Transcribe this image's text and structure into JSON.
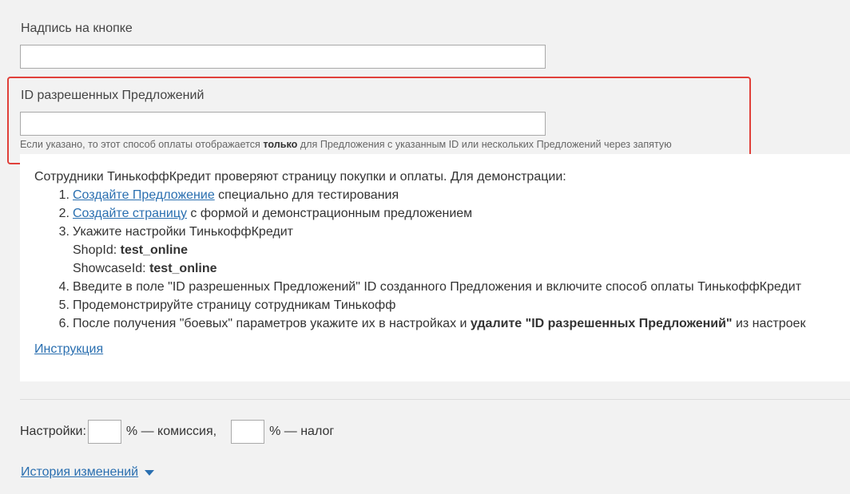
{
  "button_caption": {
    "label": "Надпись на кнопке",
    "value": ""
  },
  "allowed_offers": {
    "label": "ID разрешенных Предложений",
    "value": "",
    "hint_before": "Если указано, то этот способ оплаты отображается ",
    "hint_bold": "только",
    "hint_after": " для Предложения с указанным ID или нескольких Предложений через запятую"
  },
  "info": {
    "intro": "Сотрудники ТинькоффКредит проверяют страницу покупки и оплаты. Для демонстрации:",
    "steps": [
      {
        "num": "1.",
        "link": "Создайте Предложение",
        "text": " специально для тестирования"
      },
      {
        "num": "2.",
        "link": "Создайте страницу",
        "text": " с формой и демонстрационным предложением"
      },
      {
        "num": "3.",
        "text": "Укажите настройки ТинькоффКредит"
      },
      {
        "num": "4.",
        "text": "Введите в поле \"ID разрешенных Предложений\" ID созданного Предложения и включите способ оплаты ТинькоффКредит"
      },
      {
        "num": "5.",
        "text": "Продемонстрируйте страницу сотрудникам Тинькофф"
      },
      {
        "num": "6.",
        "text": "После получения \"боевых\" параметров укажите их в настройках и ",
        "bold": "удалите \"ID разрешенных Предложений\"",
        "text_after": " из настроек"
      }
    ],
    "shop_id_label": "ShopId: ",
    "shop_id_value": "test_online",
    "showcase_id_label": "ShowcaseId: ",
    "showcase_id_value": "test_online",
    "instruction_link": "Инструкция"
  },
  "settings": {
    "label": "Настройки:",
    "commission_value": "",
    "commission_suffix": "% — комиссия,",
    "tax_value": "",
    "tax_suffix": "% — налог"
  },
  "history": {
    "label": "История изменений",
    "icon": "caret-down-icon"
  },
  "colors": {
    "link": "#2a6fb0",
    "highlight_border": "#e0403a",
    "page_bg": "#f2f2f2"
  }
}
